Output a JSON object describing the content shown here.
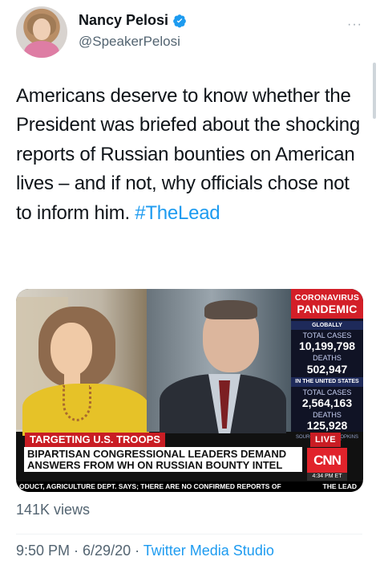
{
  "user": {
    "name": "Nancy Pelosi",
    "handle": "@SpeakerPelosi",
    "verified_icon": "verified-badge-icon"
  },
  "more_label": "···",
  "tweet": {
    "text": "Americans deserve to know whether the President was briefed about the shocking reports of Russian bounties on American lives – and if not, why officials chose not to inform him. ",
    "hashtag": "#TheLead"
  },
  "media": {
    "banner_tag": "TARGETING U.S. TROOPS",
    "headline": "BIPARTISAN CONGRESSIONAL LEADERS DEMAND ANSWERS FROM WH ON RUSSIAN BOUNTY INTEL",
    "live": "LIVE",
    "network": "CNN",
    "time": "4:34 PM ET",
    "ticker": "ODUCT, AGRICULTURE DEPT. SAYS; THERE ARE NO CONFIRMED REPORTS OF",
    "show_name": "THE LEAD",
    "stats": {
      "title_top": "CORONAVIRUS",
      "title_bottom": "PANDEMIC",
      "global_label": "GLOBALLY",
      "total_cases_label": "TOTAL CASES",
      "global_total_cases": "10,199,798",
      "deaths_label": "DEATHS",
      "global_deaths": "502,947",
      "us_label": "IN THE UNITED STATES",
      "us_total_cases_label": "TOTAL CASES",
      "us_total_cases": "2,564,163",
      "us_deaths_label": "DEATHS",
      "us_deaths": "125,928",
      "source": "SOURCE: JOHNS HOPKINS UNIVERSITY"
    }
  },
  "views": "141K views",
  "meta": {
    "timestamp": "9:50 PM · 6/29/20 · ",
    "source": "Twitter Media Studio"
  }
}
